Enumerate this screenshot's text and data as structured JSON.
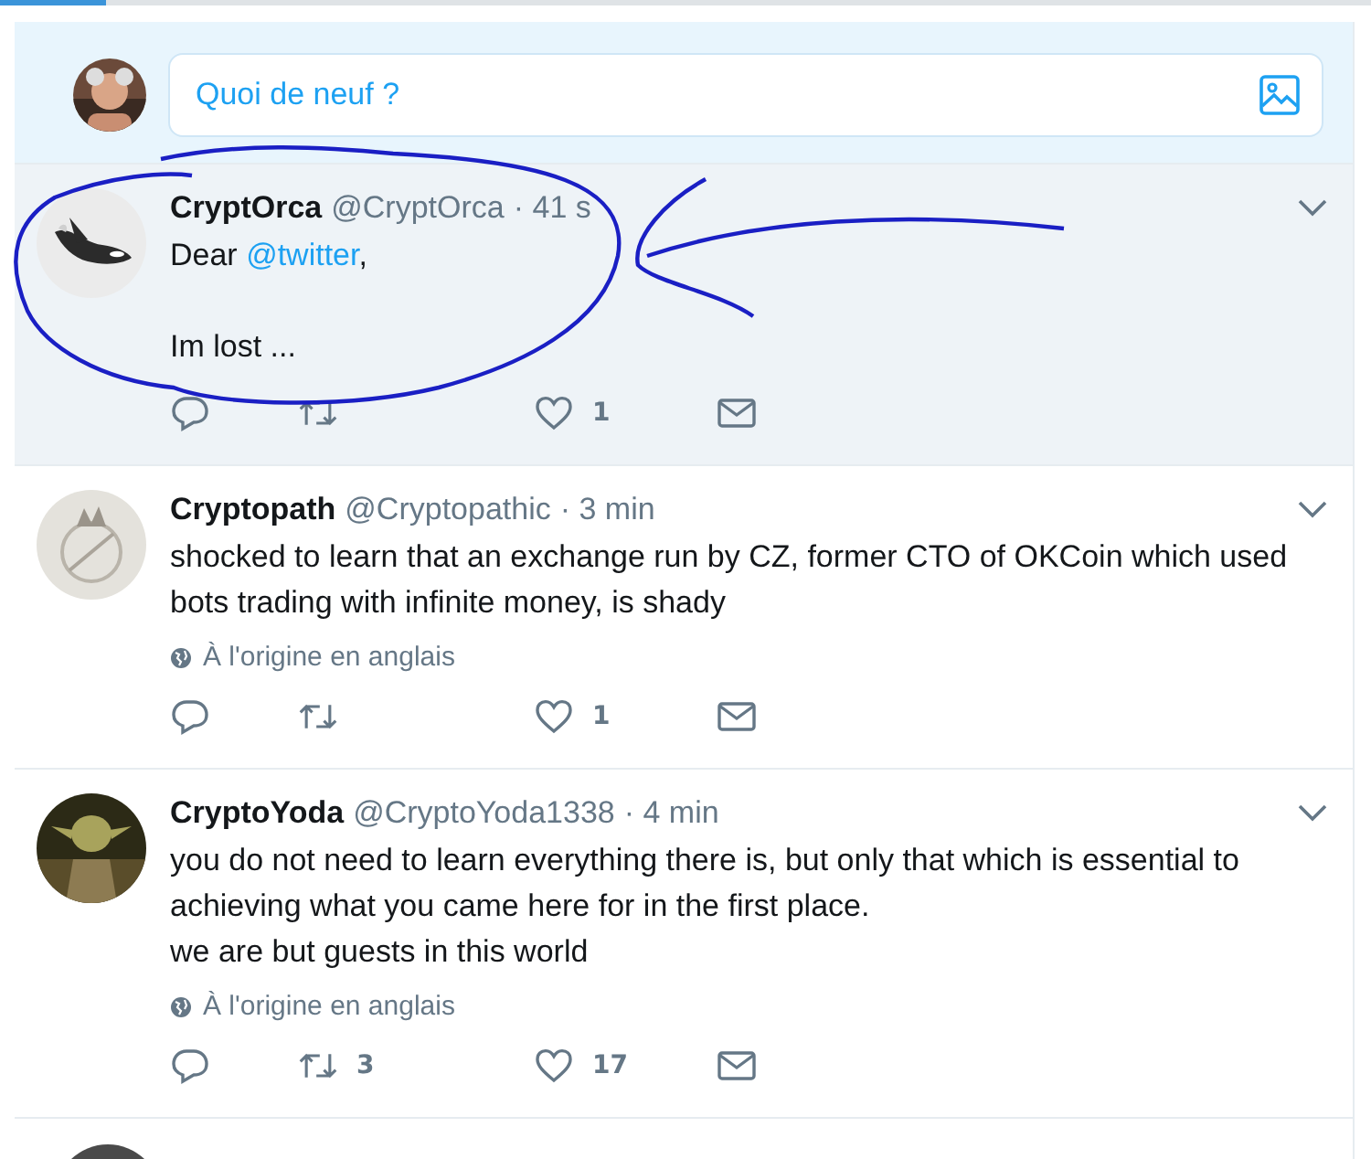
{
  "compose": {
    "placeholder": "Quoi de neuf ?"
  },
  "tweets": [
    {
      "name": "CryptOrca",
      "handle": "@CryptOrca",
      "time": "· 41 s",
      "highlighted": true,
      "lines": [
        {
          "spaced": false,
          "parts": [
            {
              "kind": "text",
              "text": "Dear "
            },
            {
              "kind": "mention",
              "text": "@twitter"
            },
            {
              "kind": "text",
              "text": ","
            }
          ]
        },
        {
          "spaced": true,
          "parts": [
            {
              "kind": "text",
              "text": "Im lost ..."
            }
          ]
        }
      ],
      "likes": "1"
    },
    {
      "name": "Cryptopath",
      "handle": "@Cryptopathic",
      "time": "· 3 min",
      "highlighted": false,
      "lines": [
        {
          "spaced": false,
          "parts": [
            {
              "kind": "text",
              "text": "shocked to learn that an exchange run by CZ, former CTO of OKCoin which used bots trading with infinite money, is shady"
            }
          ]
        }
      ],
      "translation": "À l'origine en anglais",
      "likes": "1"
    },
    {
      "name": "CryptoYoda",
      "handle": "@CryptoYoda1338",
      "time": "· 4 min",
      "highlighted": false,
      "lines": [
        {
          "spaced": false,
          "parts": [
            {
              "kind": "text",
              "text": "you do not need to learn everything there is, but only that which is essential to achieving what you came here for in the first place."
            }
          ]
        },
        {
          "spaced": false,
          "parts": [
            {
              "kind": "text",
              "text": "we are but guests in this world"
            }
          ]
        }
      ],
      "translation": "À l'origine en anglais",
      "retweets": "3",
      "likes": "17"
    }
  ]
}
